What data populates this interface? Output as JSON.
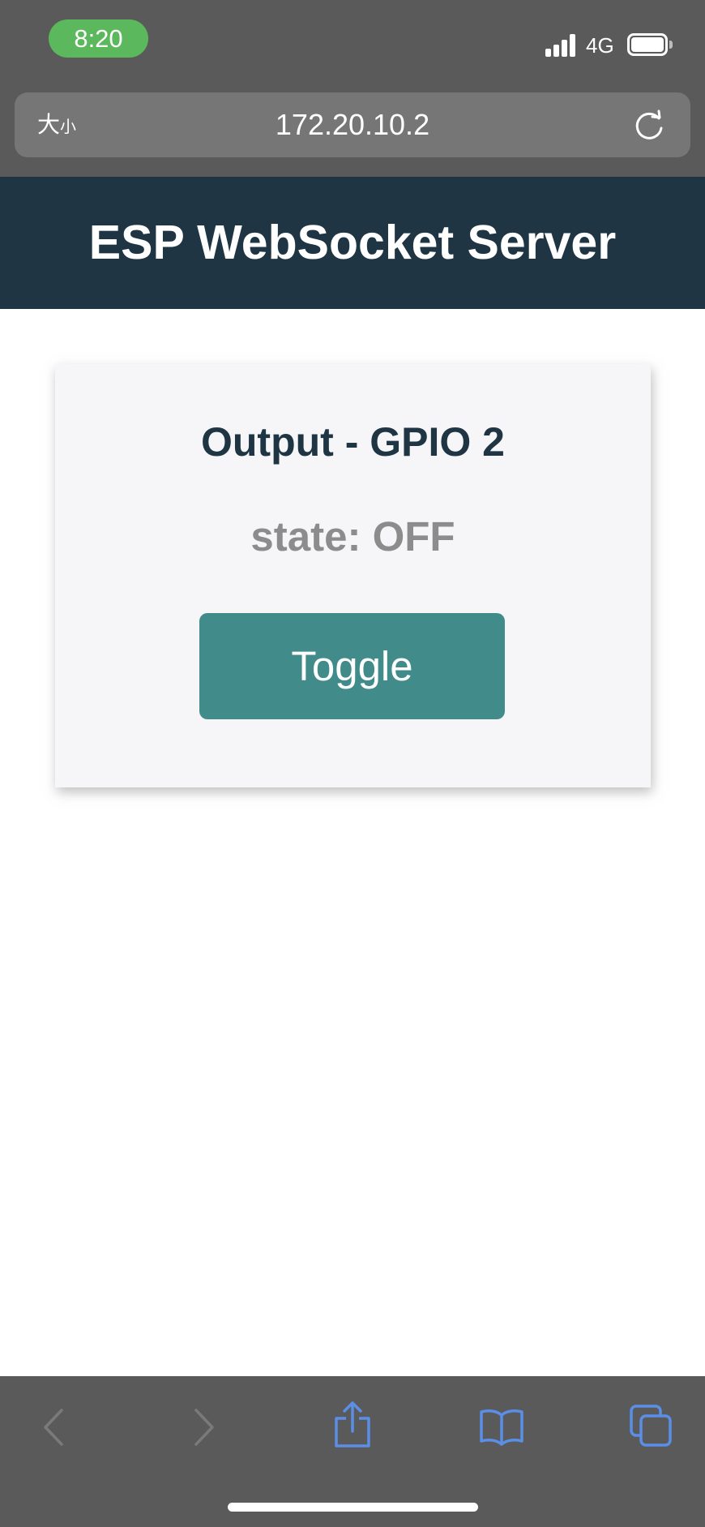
{
  "status_bar": {
    "time": "8:20",
    "network": "4G",
    "battery_level": 1.0,
    "signal_bars": 4
  },
  "browser": {
    "text_size_label_large": "大",
    "text_size_label_small": "小",
    "url": "172.20.10.2"
  },
  "page": {
    "header_title": "ESP WebSocket Server",
    "card_title": "Output - GPIO 2",
    "state_label": "state: ",
    "state_value": "OFF",
    "toggle_label": "Toggle"
  },
  "toolbar": {
    "icons": [
      "back-icon",
      "forward-icon",
      "share-icon",
      "bookmarks-icon",
      "tabs-icon"
    ]
  },
  "colors": {
    "header_bg": "#1f3543",
    "button_bg": "#418b8b",
    "chrome_bg": "#5a5a5a",
    "toolbar_active_icon": "#5b8ee6",
    "toolbar_disabled_icon": "#7a7a7a"
  }
}
